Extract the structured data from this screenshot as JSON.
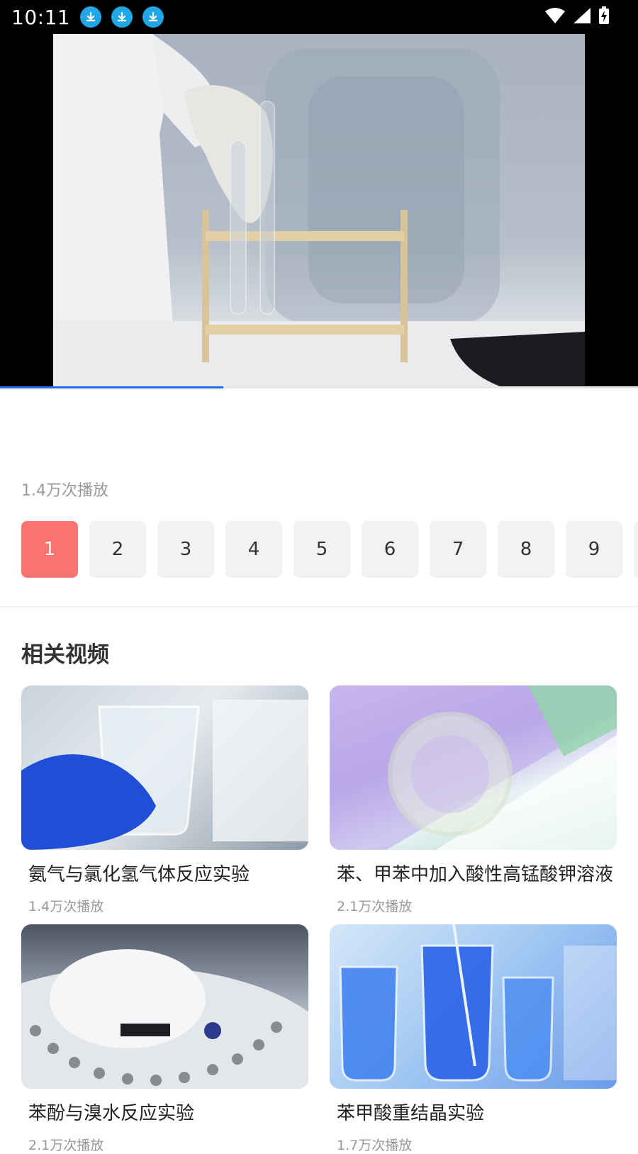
{
  "status_bar": {
    "time": "10:11",
    "icons": [
      "download-icon",
      "download-icon",
      "download-icon",
      "wifi-icon",
      "signal-icon",
      "battery-charging-icon"
    ]
  },
  "video": {
    "progress": 0.35,
    "progress_color": "#1e6fe0"
  },
  "plays": "1.4万次播放",
  "episodes": {
    "items": [
      "1",
      "2",
      "3",
      "4",
      "5",
      "6",
      "7",
      "8",
      "9"
    ],
    "active_index": 0,
    "active_color": "#fb7474"
  },
  "related": {
    "title": "相关视频",
    "items": [
      {
        "title": "氨气与氯化氢气体反应实验",
        "plays": "1.4万次播放"
      },
      {
        "title": "苯、甲苯中加入酸性高锰酸钾溶液",
        "plays": "2.1万次播放"
      },
      {
        "title": "苯酚与溴水反应实验",
        "plays": "2.1万次播放"
      },
      {
        "title": "苯甲酸重结晶实验",
        "plays": "1.7万次播放"
      }
    ]
  }
}
